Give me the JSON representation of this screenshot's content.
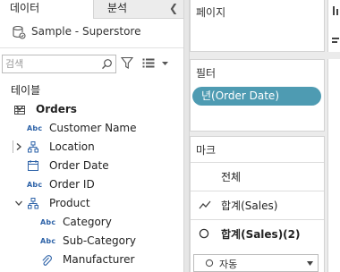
{
  "data_pane": {
    "tab_data": "데이터",
    "tab_analysis": "분석",
    "datasource_name": "Sample - Superstore",
    "search_placeholder": "검색",
    "tables_label": "테이블",
    "fields": [
      {
        "label": "Orders",
        "type": "table",
        "expanded": true
      },
      {
        "label": "Customer Name",
        "type": "abc"
      },
      {
        "label": "Location",
        "type": "hierarchy",
        "expanded": false
      },
      {
        "label": "Order Date",
        "type": "date"
      },
      {
        "label": "Order ID",
        "type": "abc"
      },
      {
        "label": "Product",
        "type": "hierarchy",
        "expanded": true
      },
      {
        "label": "Category",
        "type": "abc"
      },
      {
        "label": "Sub-Category",
        "type": "abc"
      },
      {
        "label": "Manufacturer",
        "type": "group"
      }
    ]
  },
  "shelves": {
    "pages_title": "페이지",
    "filters_title": "필터",
    "filter_pill": "년(Order Date)",
    "marks_title": "마크",
    "marks_rows": [
      {
        "label": "전체",
        "icon": "none"
      },
      {
        "label": "합계(Sales)",
        "icon": "line-icon"
      },
      {
        "label": "합계(Sales)(2)",
        "icon": "circle-icon"
      }
    ],
    "mark_type": "자동"
  },
  "colors": {
    "pill": "#4e9bb2",
    "abc_icon": "#2e63a8",
    "hierarchy_icon": "#2e63a8"
  }
}
